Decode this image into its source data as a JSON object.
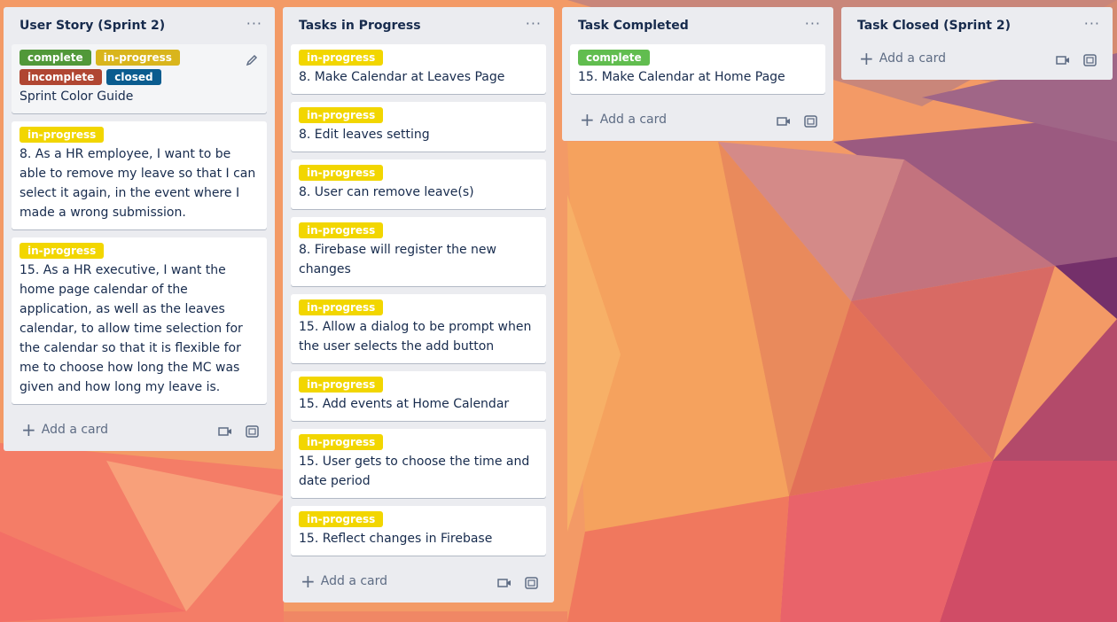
{
  "lists": [
    {
      "title": "User Story (Sprint 2)",
      "menu": "···",
      "cards": [
        {
          "labels": [
            "complete",
            "in-progress",
            "incomplete",
            "closed"
          ],
          "title": "Sprint Color Guide"
        },
        {
          "labels": [
            "in-progress"
          ],
          "title": "8. As a HR employee, I want to be able to remove my leave so that I can select it again, in the event where I made a wrong submission."
        },
        {
          "labels": [
            "in-progress"
          ],
          "title": "15. As a HR executive, I want the home page calendar of the application, as well as the leaves calendar, to allow time selection for the calendar so that it is flexible for me to choose how long the MC was given and how long my leave is."
        }
      ],
      "add_card": "Add a card"
    },
    {
      "title": "Tasks in Progress",
      "menu": "···",
      "cards": [
        {
          "labels": [
            "in-progress"
          ],
          "title": "8. Make Calendar at Leaves Page"
        },
        {
          "labels": [
            "in-progress"
          ],
          "title": "8. Edit leaves setting"
        },
        {
          "labels": [
            "in-progress"
          ],
          "title": "8. User can remove leave(s)"
        },
        {
          "labels": [
            "in-progress"
          ],
          "title": "8. Firebase will register the new changes"
        },
        {
          "labels": [
            "in-progress"
          ],
          "title": "15. Allow a dialog to be prompt when the user selects the add button"
        },
        {
          "labels": [
            "in-progress"
          ],
          "title": "15. Add events at Home Calendar"
        },
        {
          "labels": [
            "in-progress"
          ],
          "title": "15. User gets to choose the time and date period"
        },
        {
          "labels": [
            "in-progress"
          ],
          "title": "15. Reflect changes in Firebase"
        }
      ],
      "add_card": "Add a card"
    },
    {
      "title": "Task Completed",
      "menu": "···",
      "cards": [
        {
          "labels": [
            "complete"
          ],
          "title": "15. Make Calendar at Home Page"
        }
      ],
      "add_card": "Add a card"
    },
    {
      "title": "Task Closed (Sprint 2)",
      "menu": "···",
      "cards": [],
      "add_card": "Add a card"
    }
  ],
  "colors": {
    "complete": "#61bd4f",
    "in-progress": "#f2d600",
    "incomplete": "#b04632",
    "closed": "#0a5c8f",
    "list_bg": "#ebecf0"
  },
  "icons": [
    "plus-icon",
    "camera-icon",
    "template-icon",
    "pencil-icon"
  ]
}
